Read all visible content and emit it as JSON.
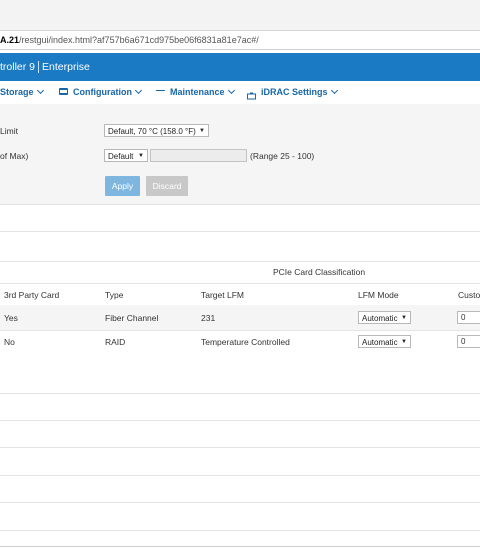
{
  "browser": {
    "address_host": "A.21",
    "address_path": "/restgui/index.html?af757b6a671cd975be06f6831a81e7ac#/"
  },
  "header": {
    "product_left": "troller 9",
    "product_right": "Enterprise"
  },
  "menu": {
    "items": [
      {
        "label": "Storage"
      },
      {
        "label": "Configuration"
      },
      {
        "label": "Maintenance"
      },
      {
        "label": "iDRAC Settings"
      }
    ]
  },
  "settings": {
    "limit_label": "Limit",
    "limit_value": "Default, 70 °C (158.0 °F)",
    "max_label": "of Max)",
    "max_value": "Default",
    "range_text": "(Range 25 - 100)",
    "apply_label": "Apply",
    "discard_label": "Discard"
  },
  "table": {
    "group_header": "PCIe Card Classification",
    "columns": [
      "3rd Party Card",
      "Type",
      "Target LFM",
      "LFM Mode",
      "Custo"
    ],
    "rows": [
      {
        "third_party": "Yes",
        "type": "Fiber Channel",
        "target_lfm": "231",
        "lfm_mode": "Automatic",
        "custom": "0"
      },
      {
        "third_party": "No",
        "type": "RAID",
        "target_lfm": "Temperature Controlled",
        "lfm_mode": "Automatic",
        "custom": "0"
      }
    ]
  }
}
